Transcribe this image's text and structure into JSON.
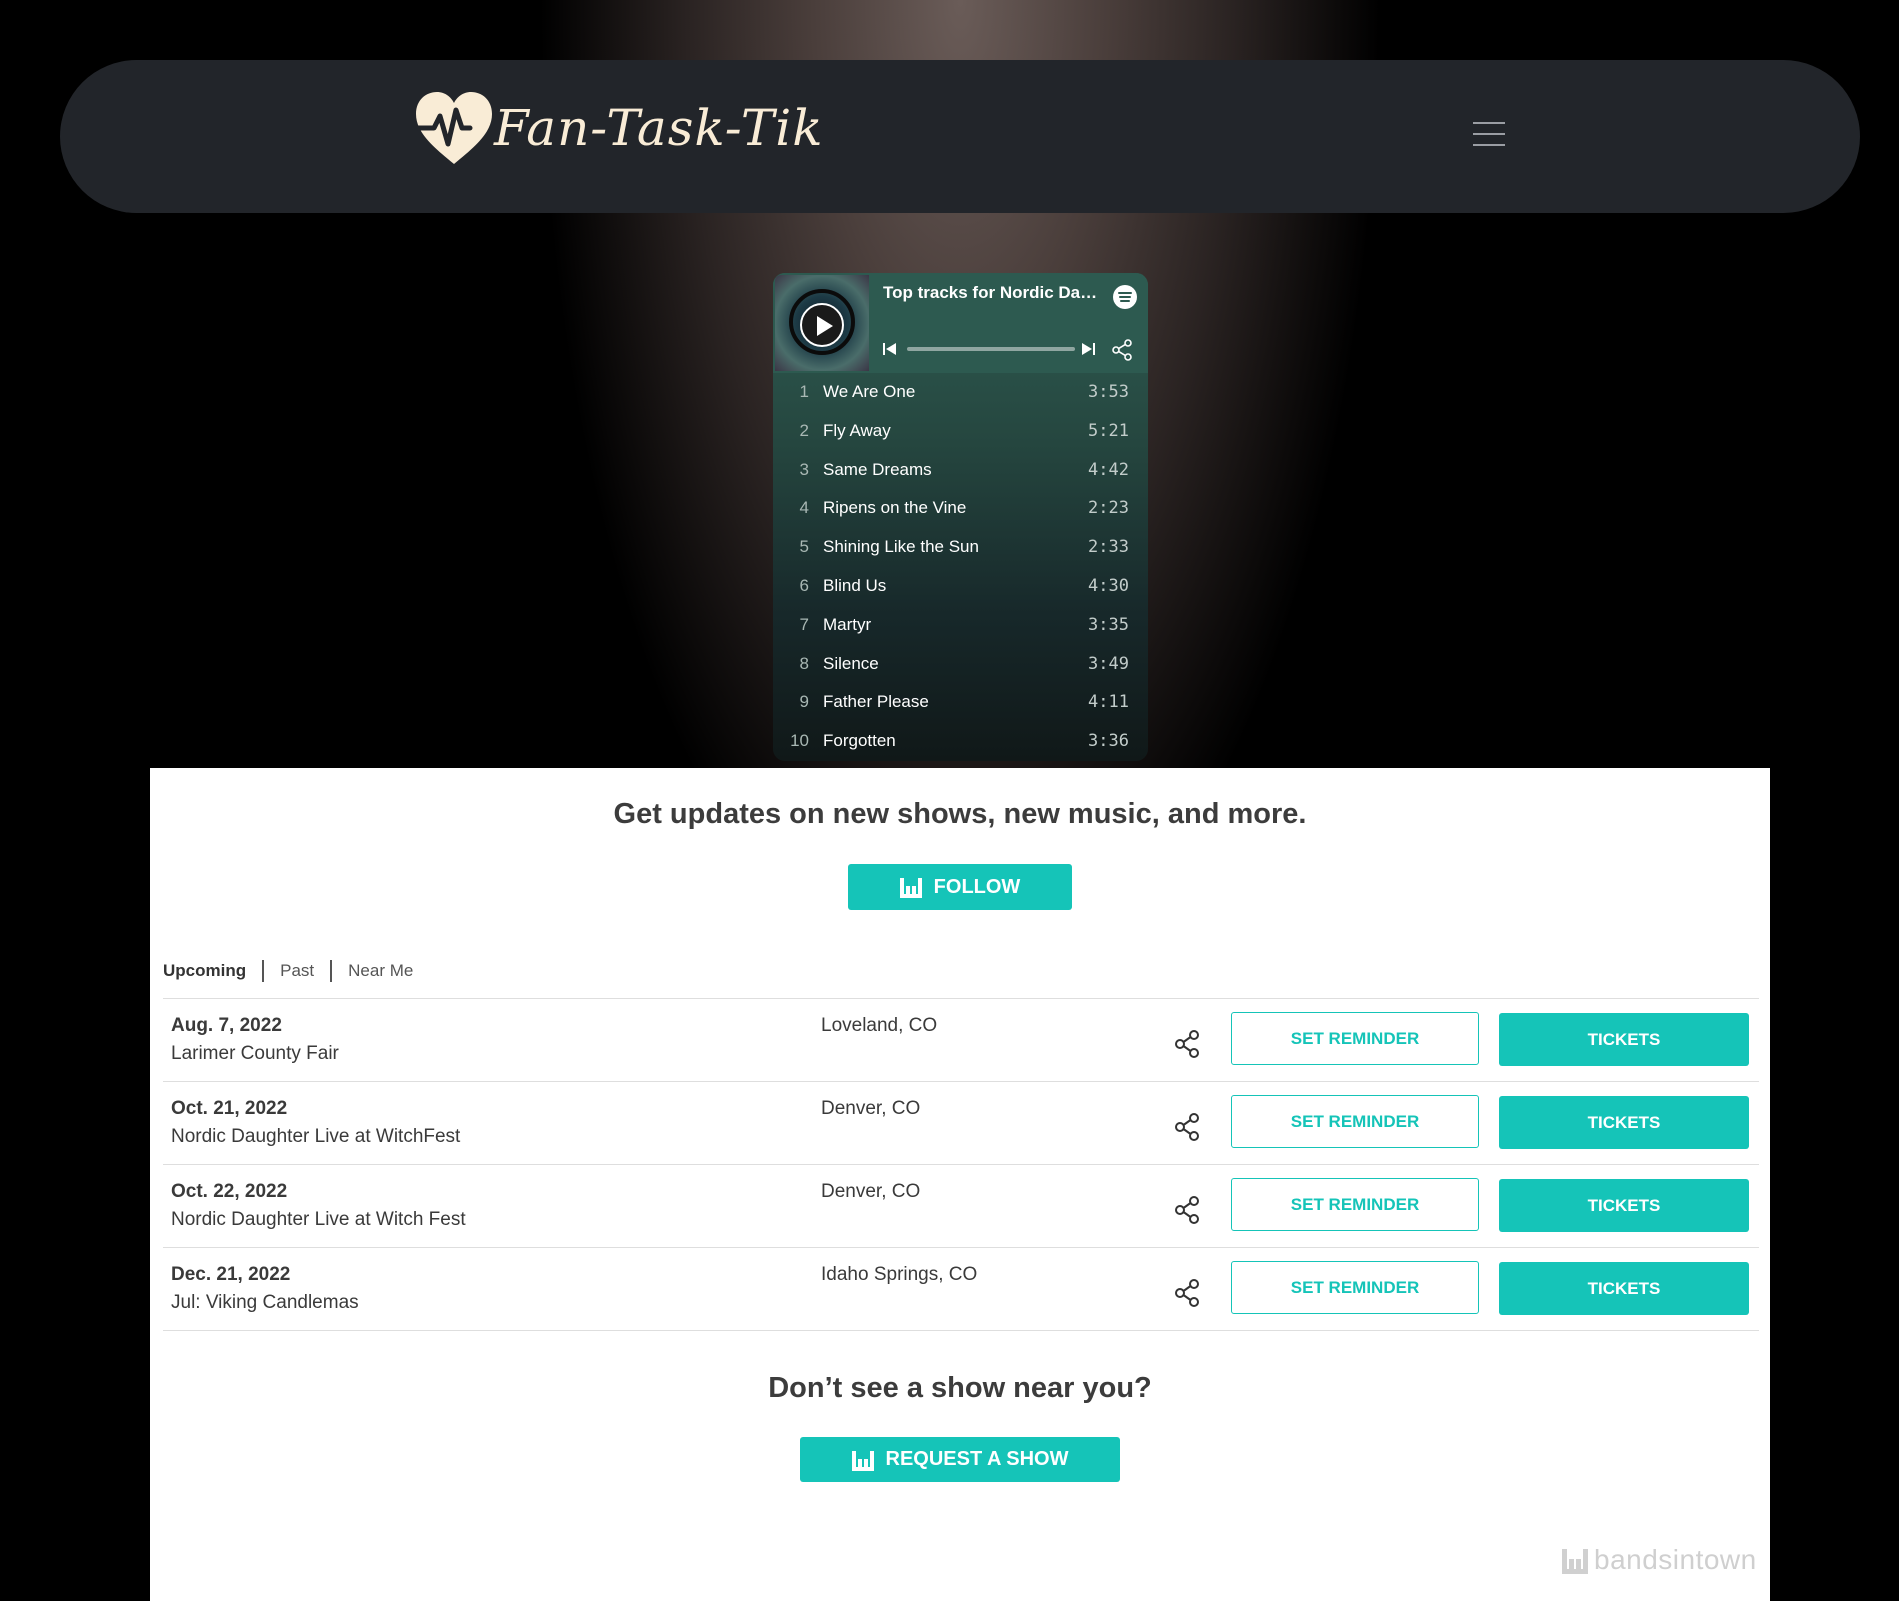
{
  "brand": {
    "name": "Fan-Task-Tik",
    "logo_icon": "heart-pulse-icon",
    "logo_color": "#f9ecd6"
  },
  "nav": {
    "menu_icon": "hamburger-menu-icon"
  },
  "spotify": {
    "title": "Top tracks for Nordic Daughter",
    "tracks": [
      {
        "num": "1",
        "name": "We Are One",
        "duration": "3:53"
      },
      {
        "num": "2",
        "name": "Fly Away",
        "duration": "5:21"
      },
      {
        "num": "3",
        "name": "Same Dreams",
        "duration": "4:42"
      },
      {
        "num": "4",
        "name": "Ripens on the Vine",
        "duration": "2:23"
      },
      {
        "num": "5",
        "name": "Shining Like the Sun",
        "duration": "2:33"
      },
      {
        "num": "6",
        "name": "Blind Us",
        "duration": "4:30"
      },
      {
        "num": "7",
        "name": "Martyr",
        "duration": "3:35"
      },
      {
        "num": "8",
        "name": "Silence",
        "duration": "3:49"
      },
      {
        "num": "9",
        "name": "Father Please",
        "duration": "4:11"
      },
      {
        "num": "10",
        "name": "Forgotten",
        "duration": "3:36"
      }
    ]
  },
  "bandsintown": {
    "headline": "Get updates on new shows, new music, and more.",
    "follow_label": "FOLLOW",
    "tabs": [
      {
        "label": "Upcoming",
        "active": true
      },
      {
        "label": "Past",
        "active": false
      },
      {
        "label": "Near Me",
        "active": false
      }
    ],
    "events": [
      {
        "date": "Aug. 7, 2022",
        "venue": "Larimer County Fair",
        "location": "Loveland, CO"
      },
      {
        "date": "Oct. 21, 2022",
        "venue": "Nordic Daughter Live at WitchFest",
        "location": "Denver, CO"
      },
      {
        "date": "Oct. 22, 2022",
        "venue": "Nordic Daughter Live at Witch Fest",
        "location": "Denver, CO"
      },
      {
        "date": "Dec. 21, 2022",
        "venue": "Jul: Viking Candlemas",
        "location": "Idaho Springs, CO"
      }
    ],
    "reminder_label": "SET REMINDER",
    "tickets_label": "TICKETS",
    "near_question": "Don’t see a show near you?",
    "request_label": "REQUEST A SHOW",
    "brand_text": "bandsintown",
    "accent": "#15c4b8"
  }
}
